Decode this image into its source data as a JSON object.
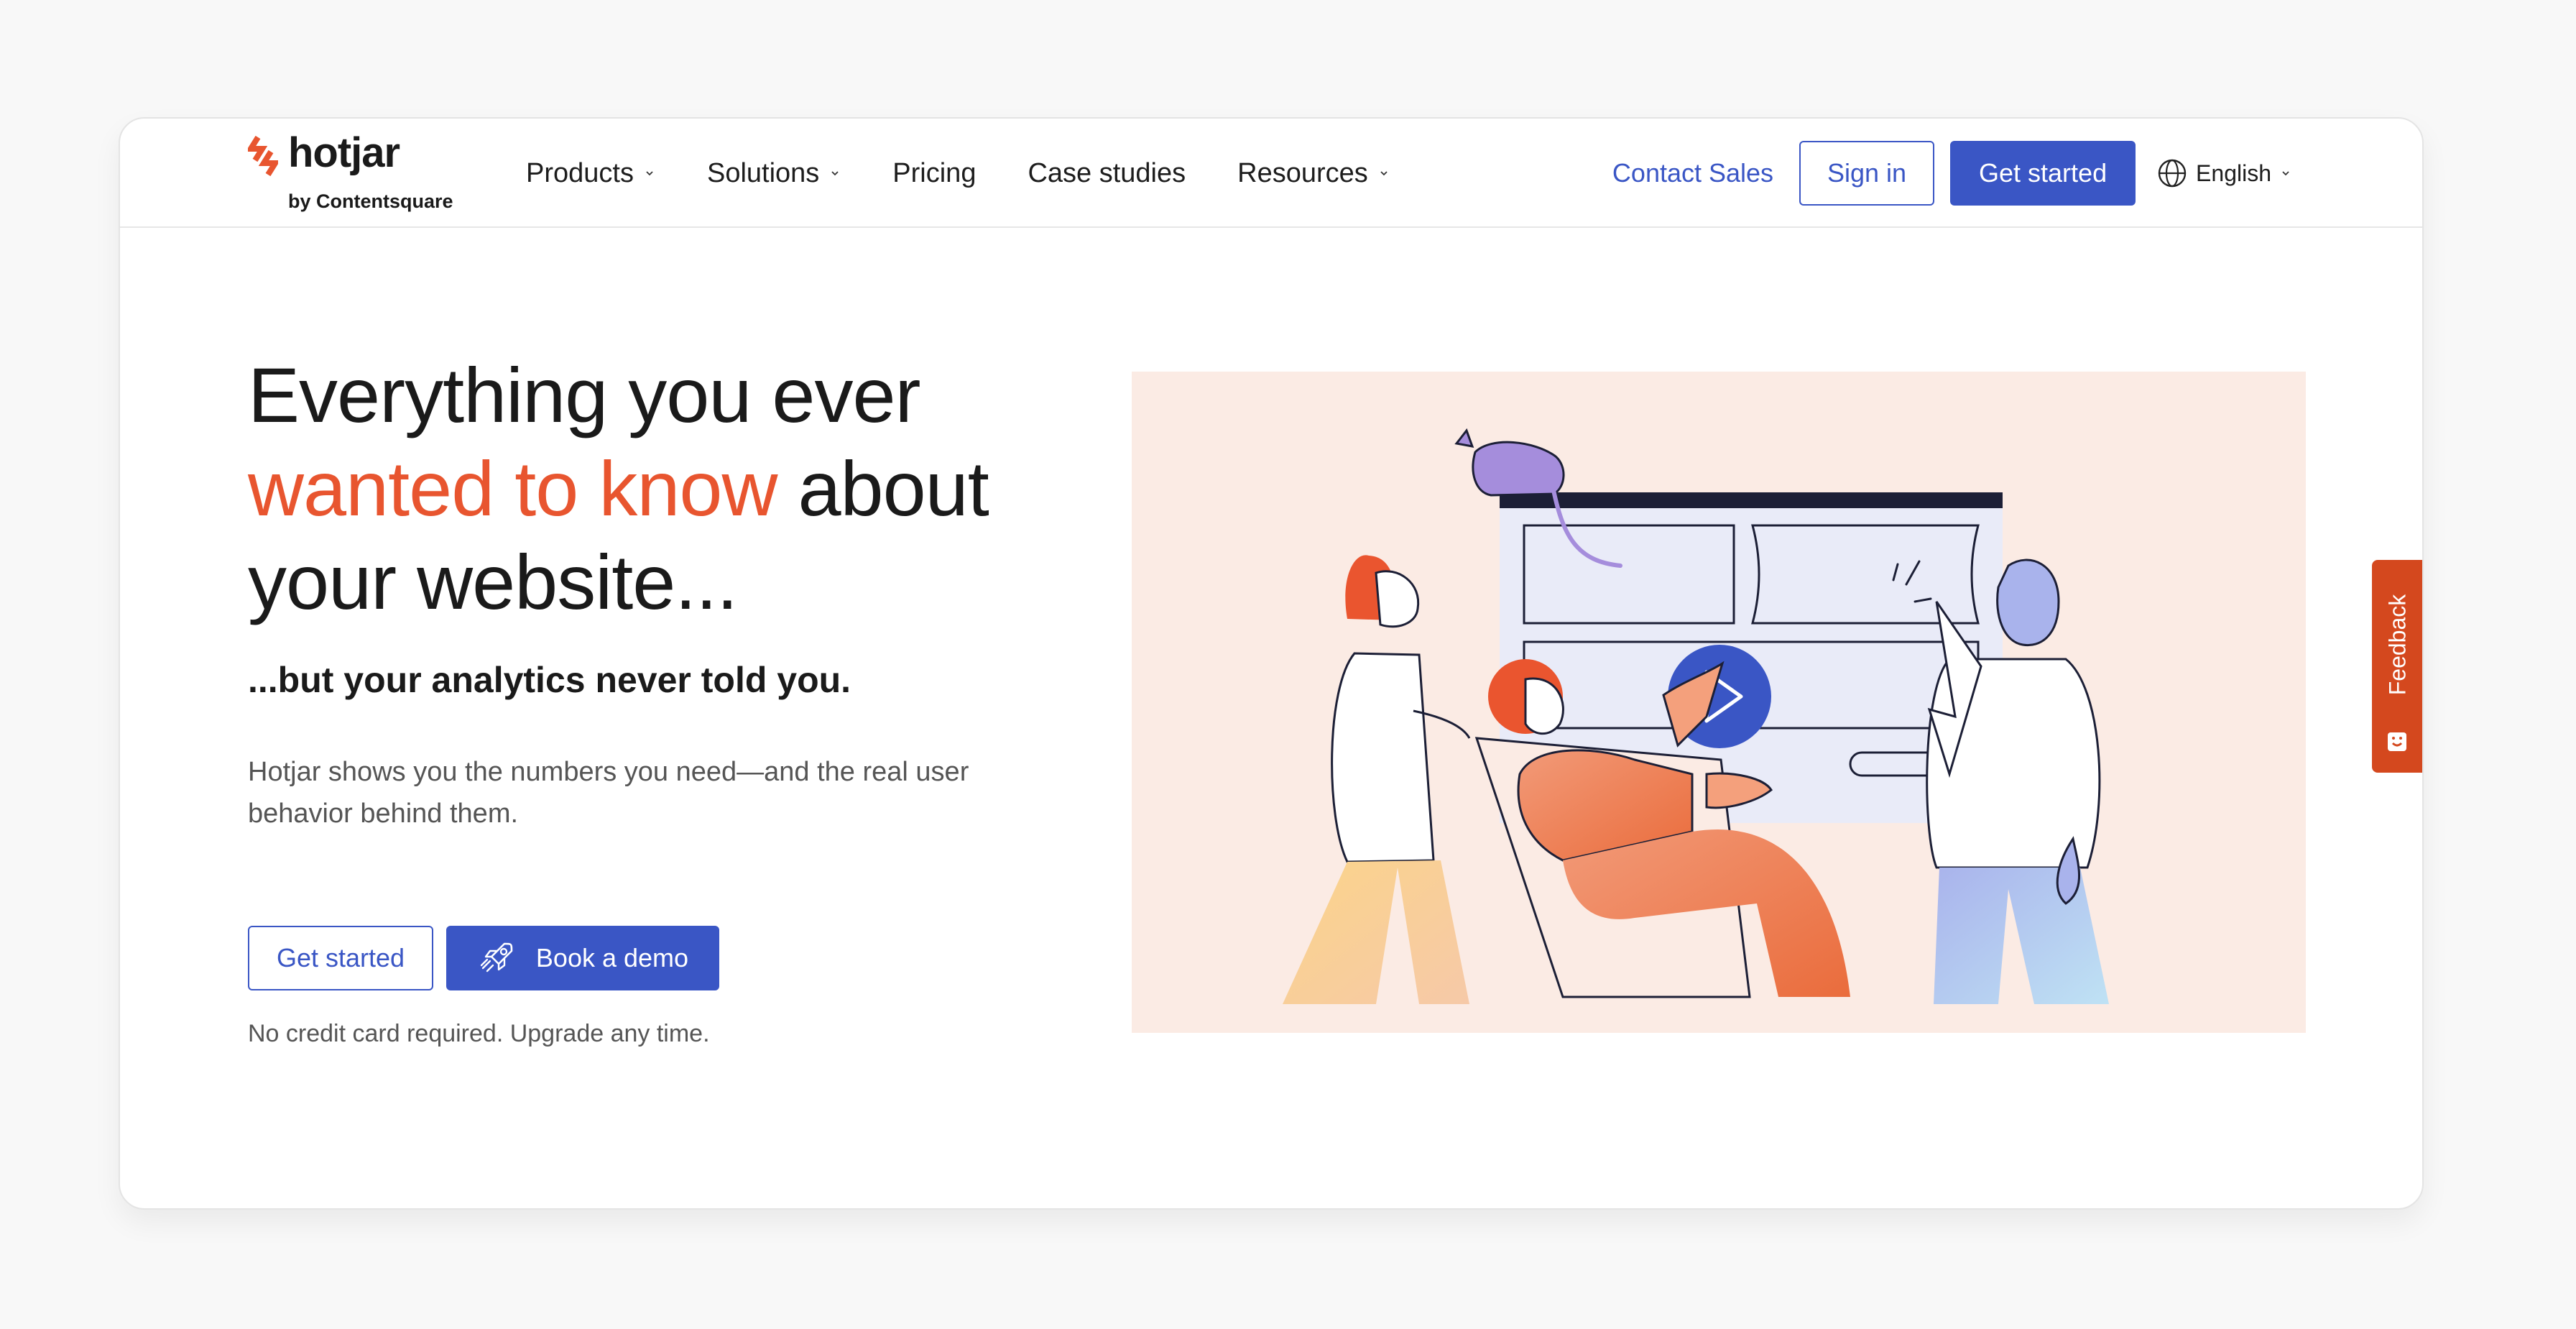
{
  "brand": {
    "name": "hotjar",
    "sub": "by Contentsquare",
    "accent_color": "#e8552f",
    "primary_color": "#3a56c5"
  },
  "nav": {
    "items": [
      {
        "label": "Products",
        "has_dropdown": true
      },
      {
        "label": "Solutions",
        "has_dropdown": true
      },
      {
        "label": "Pricing",
        "has_dropdown": false
      },
      {
        "label": "Case studies",
        "has_dropdown": false
      },
      {
        "label": "Resources",
        "has_dropdown": true
      }
    ],
    "contact_sales": "Contact Sales",
    "sign_in": "Sign in",
    "get_started": "Get started",
    "language": "English"
  },
  "hero": {
    "title_line1": "Everything you ever",
    "title_accent": "wanted to know",
    "title_after_accent": " about",
    "title_line3": "your website...",
    "subhead": "...but your analytics never told you.",
    "body": "Hotjar shows you the numbers you need—and the real user behavior behind them.",
    "cta_primary": "Get started",
    "cta_secondary": "Book a demo",
    "note": "No credit card required. Upgrade any time."
  },
  "illustration": {
    "background": "#fbebe4",
    "play_button_color": "#3a56c5"
  },
  "feedback_tab": {
    "label": "Feedback",
    "color": "#d4481e"
  },
  "chat_widget": {
    "icon": "chat-bubble-icon"
  }
}
